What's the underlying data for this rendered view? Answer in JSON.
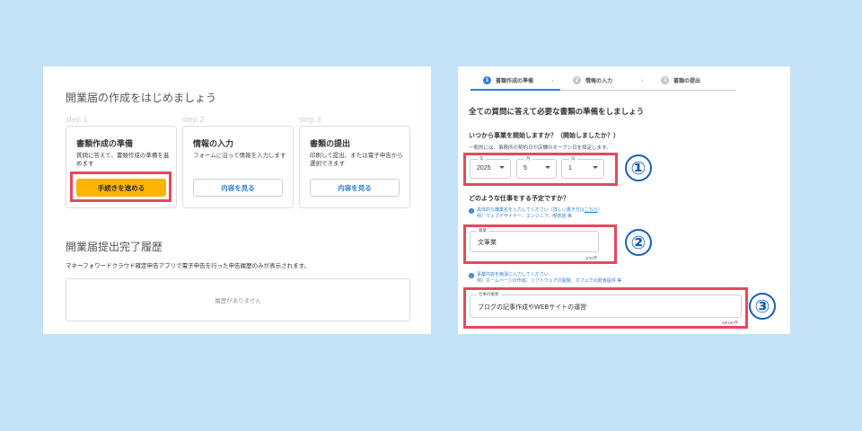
{
  "left": {
    "title": "開業届の作成をはじめましょう",
    "steps": [
      {
        "label": "step 1",
        "title": "書類作成の準備",
        "desc": "質問に答えて、書類作成の準備を進めます",
        "button": "手続きを進める"
      },
      {
        "label": "step 2",
        "title": "情報の入力",
        "desc": "フォームに沿って情報を入力します",
        "button": "内容を見る"
      },
      {
        "label": "step 3",
        "title": "書類の提出",
        "desc": "印刷して提出、または電子申告から選択できます",
        "button": "内容を見る"
      }
    ],
    "history_title": "開業届提出完了履歴",
    "history_desc": "マネーフォワードクラウド確定申告アプリで電子申告を行った申告履歴のみが表示されます。",
    "history_empty": "履歴がありません"
  },
  "right": {
    "stepper": [
      {
        "num": "1",
        "label": "書類作成の準備"
      },
      {
        "num": "2",
        "label": "情報の入力"
      },
      {
        "num": "3",
        "label": "書類の提出"
      }
    ],
    "title": "全ての質問に答えて必要な書類の準備をしましょう",
    "q1": "いつから事業を開始しますか？（開始しましたか？）",
    "q1_note": "一般的には、事務所の契約日や店舗のオープン日を設定します。",
    "date": {
      "year_label": "年",
      "year": "2025",
      "month_label": "月",
      "month": "5",
      "day_label": "日",
      "day": "1"
    },
    "q2": "どのような仕事をする予定ですか？",
    "info1_line1": "具体的な職業名を入力してください（詳しい書き方は",
    "info1_link": "こちら",
    "info1_line1_end": "）",
    "info1_line2": "例）ウェブデザイナー、エンジニア、喫茶店 等",
    "job_label": "職業",
    "job_value": "文筆業",
    "job_counter": "3/20字",
    "info2_line1": "事業内容を簡潔に入力してください",
    "info2_line2": "例）ホームページの作成、ソフトウェアの開発、カフェでの飲食提供 等",
    "work_label": "仕事の概要",
    "work_value": "ブログの記事作成やWEBサイトの運営",
    "work_counter": "18/100字"
  },
  "callouts": [
    "①",
    "②",
    "③"
  ],
  "colors": {
    "background": "#c3e2f8",
    "highlight": "#e8475f",
    "primary_button": "#ffb400",
    "accent": "#2f7fd4",
    "callout": "#1a5fb4"
  },
  "icons": {
    "info": "info-circle-icon",
    "select_arrow": "caret-down-icon",
    "stepper_chevron": "chevron-right-icon"
  }
}
